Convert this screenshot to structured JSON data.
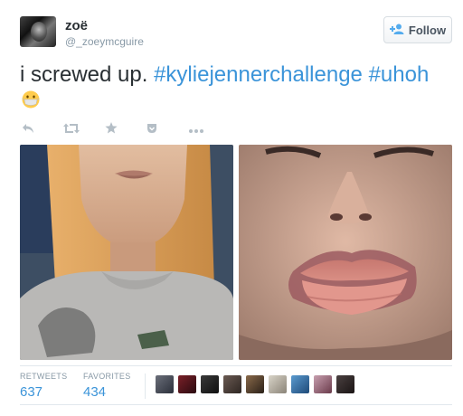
{
  "user": {
    "name": "zoë",
    "handle": "@_zoeymcguire"
  },
  "follow": {
    "label": "Follow",
    "icon": "add-user-icon"
  },
  "tweet": {
    "text_plain": "i screwed up. ",
    "hashtag1": "#kyliejennerchallenge",
    "hashtag2": "#uhoh",
    "emoji": "face-with-medical-mask"
  },
  "actions": [
    {
      "name": "reply",
      "icon": "reply-icon"
    },
    {
      "name": "retweet",
      "icon": "retweet-icon"
    },
    {
      "name": "favorite",
      "icon": "star-icon"
    },
    {
      "name": "save",
      "icon": "pocket-icon"
    },
    {
      "name": "more",
      "icon": "more-icon"
    }
  ],
  "stats": {
    "retweets_label": "RETWEETS",
    "retweets_value": "637",
    "favorites_label": "FAVORITES",
    "favorites_value": "434"
  },
  "colors": {
    "link": "#3b94d9",
    "text": "#292f33",
    "muted": "#8899a6",
    "border": "#e1e8ed"
  }
}
